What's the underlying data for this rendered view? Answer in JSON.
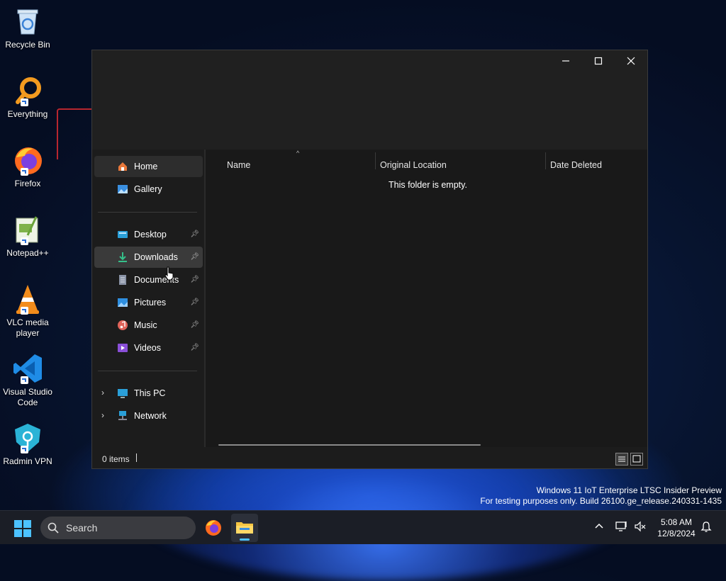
{
  "desktop": {
    "icons": [
      {
        "label": "Recycle Bin",
        "icon": "recycle-bin-icon"
      },
      {
        "label": "Everything",
        "icon": "everything-search-icon"
      },
      {
        "label": "Firefox",
        "icon": "firefox-icon"
      },
      {
        "label": "Notepad++",
        "icon": "notepad-plus-plus-icon"
      },
      {
        "label": "VLC media player",
        "icon": "vlc-icon"
      },
      {
        "label": "Visual Studio Code",
        "icon": "vscode-icon"
      },
      {
        "label": "Radmin VPN",
        "icon": "radmin-vpn-icon"
      }
    ],
    "watermark": {
      "line1": "Windows 11 IoT Enterprise LTSC Insider Preview",
      "line2": "For testing purposes only. Build 26100.ge_release.240331-1435"
    }
  },
  "explorer": {
    "window_controls": {
      "minimize": "—",
      "maximize": "☐",
      "close": "✕"
    },
    "nav": {
      "items": [
        {
          "label": "Home",
          "icon": "home-icon",
          "pinned": false
        },
        {
          "label": "Gallery",
          "icon": "gallery-icon",
          "pinned": false
        },
        {
          "label": "Desktop",
          "icon": "desktop-folder-icon",
          "pinned": true
        },
        {
          "label": "Downloads",
          "icon": "downloads-icon",
          "pinned": true
        },
        {
          "label": "Documents",
          "icon": "documents-icon",
          "pinned": true
        },
        {
          "label": "Pictures",
          "icon": "pictures-icon",
          "pinned": true
        },
        {
          "label": "Music",
          "icon": "music-icon",
          "pinned": true
        },
        {
          "label": "Videos",
          "icon": "videos-icon",
          "pinned": true
        },
        {
          "label": "This PC",
          "icon": "this-pc-icon",
          "expandable": true
        },
        {
          "label": "Network",
          "icon": "network-icon",
          "expandable": true
        }
      ]
    },
    "columns": [
      "Name",
      "Original Location",
      "Date Deleted"
    ],
    "empty_message": "This folder is empty.",
    "status": {
      "item_count": "0 items"
    }
  },
  "taskbar": {
    "search_label": "Search",
    "clock": {
      "time": "5:08 AM",
      "date": "12/8/2024"
    }
  },
  "colors": {
    "accent": "#4cc2ff",
    "window_bg": "#1c1c1c",
    "taskbar_bg": "#1b1e26"
  }
}
